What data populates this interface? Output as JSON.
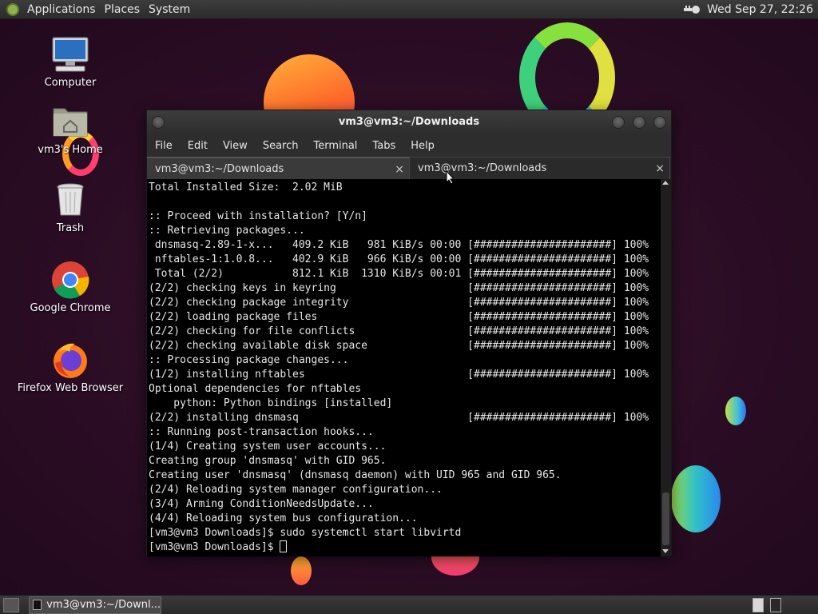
{
  "top_panel": {
    "menus": [
      "Applications",
      "Places",
      "System"
    ],
    "clock": "Wed Sep 27, 22:26"
  },
  "desktop": {
    "icons": [
      {
        "label": "Computer",
        "icon": "computer-icon"
      },
      {
        "label": "vm3's Home",
        "icon": "home-folder-icon"
      },
      {
        "label": "Trash",
        "icon": "trash-icon"
      },
      {
        "label": "Google Chrome",
        "icon": "chrome-icon"
      },
      {
        "label": "Firefox Web Browser",
        "icon": "firefox-icon"
      }
    ]
  },
  "terminal": {
    "title": "vm3@vm3:~/Downloads",
    "menus": [
      "File",
      "Edit",
      "View",
      "Search",
      "Terminal",
      "Tabs",
      "Help"
    ],
    "tabs": [
      {
        "label": "vm3@vm3:~/Downloads",
        "active": true
      },
      {
        "label": "vm3@vm3:~/Downloads",
        "active": false
      }
    ],
    "lines": [
      "Total Installed Size:  2.02 MiB",
      "",
      ":: Proceed with installation? [Y/n]",
      ":: Retrieving packages...",
      " dnsmasq-2.89-1-x...   409.2 KiB   981 KiB/s 00:00 [######################] 100%",
      " nftables-1:1.0.8...   402.9 KiB   966 KiB/s 00:00 [######################] 100%",
      " Total (2/2)           812.1 KiB  1310 KiB/s 00:01 [######################] 100%",
      "(2/2) checking keys in keyring                     [######################] 100%",
      "(2/2) checking package integrity                   [######################] 100%",
      "(2/2) loading package files                        [######################] 100%",
      "(2/2) checking for file conflicts                  [######################] 100%",
      "(2/2) checking available disk space                [######################] 100%",
      ":: Processing package changes...",
      "(1/2) installing nftables                          [######################] 100%",
      "Optional dependencies for nftables",
      "    python: Python bindings [installed]",
      "(2/2) installing dnsmasq                           [######################] 100%",
      ":: Running post-transaction hooks...",
      "(1/4) Creating system user accounts...",
      "Creating group 'dnsmasq' with GID 965.",
      "Creating user 'dnsmasq' (dnsmasq daemon) with UID 965 and GID 965.",
      "(2/4) Reloading system manager configuration...",
      "(3/4) Arming ConditionNeedsUpdate...",
      "(4/4) Reloading system bus configuration...",
      "[vm3@vm3 Downloads]$ sudo systemctl start libvirtd"
    ],
    "prompt": "[vm3@vm3 Downloads]$ ",
    "tab_close": "×"
  },
  "bottom_panel": {
    "task_label": "vm3@vm3:~/Downl..."
  }
}
